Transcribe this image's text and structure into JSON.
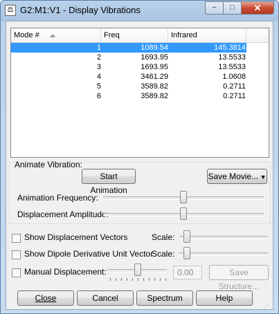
{
  "window": {
    "title": "G2:M1:V1 - Display Vibrations",
    "minimize_glyph": "−",
    "maximize_glyph": "□",
    "close_glyph": "✕"
  },
  "table": {
    "headers": [
      "Mode #",
      "Freq",
      "Infrared"
    ],
    "selected_index": 0,
    "rows": [
      {
        "mode": "1",
        "freq": "1089.54",
        "ir": "145.3814"
      },
      {
        "mode": "2",
        "freq": "1693.95",
        "ir": "13.5533"
      },
      {
        "mode": "3",
        "freq": "1693.95",
        "ir": "13.5533"
      },
      {
        "mode": "4",
        "freq": "3461.29",
        "ir": "1.0608"
      },
      {
        "mode": "5",
        "freq": "3589.82",
        "ir": "0.2711"
      },
      {
        "mode": "6",
        "freq": "3589.82",
        "ir": "0.2711"
      }
    ]
  },
  "animate": {
    "group_label": "Animate Vibration:",
    "start_label": "Start Animation",
    "save_movie_label": "Save Movie...",
    "freq_label": "Animation Frequency:",
    "amp_label": "Displacement Amplitude:",
    "freq_level": 0.5,
    "amp_level": 0.5
  },
  "options": {
    "show_vectors_label": "Show Displacement Vectors",
    "show_dipole_label": "Show Dipole Derivative Unit Vector",
    "manual_label": "Manual Displacement:",
    "scale_label": "Scale:",
    "manual_value": "0.00",
    "save_structure_label": "Save Structure...",
    "show_vectors_checked": false,
    "show_dipole_checked": false,
    "manual_checked": false
  },
  "buttons": {
    "close": "Close",
    "cancel": "Cancel",
    "spectrum": "Spectrum",
    "help": "Help"
  },
  "colors": {
    "selection": "#3399ff",
    "accent_red": "#c94b34"
  }
}
